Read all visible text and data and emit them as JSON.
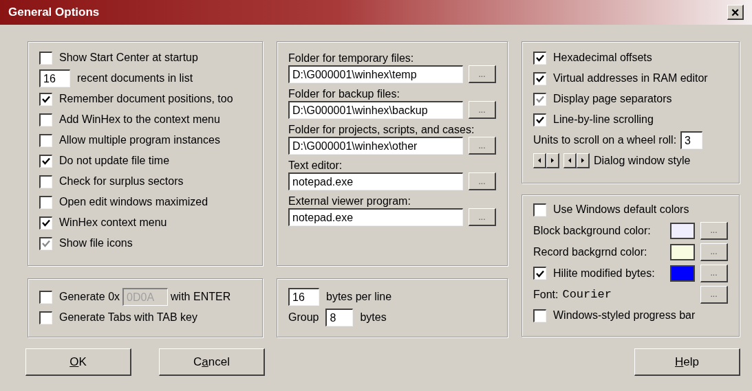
{
  "window": {
    "title": "General Options",
    "close": "×"
  },
  "general": [
    {
      "kind": "checkbox",
      "label": "Show Start Center at startup",
      "checked": false
    },
    {
      "kind": "number",
      "value": "16",
      "label": "recent documents in list"
    },
    {
      "kind": "checkbox",
      "label": "Remember document positions, too",
      "checked": true
    },
    {
      "kind": "checkbox",
      "label": "Add WinHex to the context menu",
      "checked": false
    },
    {
      "kind": "checkbox",
      "label": "Allow multiple program instances",
      "checked": false
    },
    {
      "kind": "checkbox",
      "label": "Do not update file time",
      "checked": true
    },
    {
      "kind": "checkbox",
      "label": "Check for surplus sectors",
      "checked": false
    },
    {
      "kind": "checkbox",
      "label": "Open edit windows maximized",
      "checked": false
    },
    {
      "kind": "checkbox",
      "label": "WinHex context menu",
      "checked": true
    },
    {
      "kind": "checkbox",
      "label": "Show file icons",
      "checked": true,
      "grayed": true
    }
  ],
  "folders": [
    {
      "label": "Folder for temporary files:",
      "value": "D:\\G000001\\winhex\\temp",
      "browse": "..."
    },
    {
      "label": "Folder for backup files:",
      "value": "D:\\G000001\\winhex\\backup",
      "browse": "..."
    },
    {
      "label": "Folder for projects, scripts, and cases:",
      "value": "D:\\G000001\\winhex\\other",
      "browse": "..."
    },
    {
      "label": "Text editor:",
      "value": "notepad.exe",
      "browse": "..."
    },
    {
      "label": "External viewer program:",
      "value": "notepad.exe",
      "browse": "..."
    }
  ],
  "display": [
    {
      "kind": "checkbox",
      "label": "Hexadecimal offsets",
      "checked": true
    },
    {
      "kind": "checkbox",
      "label": "Virtual addresses in RAM editor",
      "checked": true
    },
    {
      "kind": "checkbox",
      "label": "Display page separators",
      "checked": true,
      "grayed": true
    },
    {
      "kind": "checkbox",
      "label": "Line-by-line scrolling",
      "checked": true
    },
    {
      "kind": "number-after",
      "label": "Units to scroll on a wheel roll:",
      "value": "3"
    },
    {
      "kind": "style",
      "label": "Dialog window style"
    }
  ],
  "keyboard": [
    {
      "kind": "checkbox-field",
      "label": "Generate 0x",
      "value": "0D0A",
      "disabled": true,
      "suffix": "with ENTER",
      "checked": false
    },
    {
      "kind": "checkbox",
      "label": "Generate Tabs with TAB key",
      "checked": false
    }
  ],
  "layout": [
    {
      "kind": "number",
      "value": "16",
      "label": "bytes per line"
    },
    {
      "kind": "group",
      "label": "Group",
      "value": "8",
      "suffix": "bytes"
    }
  ],
  "colors": [
    {
      "kind": "checkbox",
      "label": "Use Windows default colors",
      "checked": false
    },
    {
      "kind": "color",
      "label": "Block background color:",
      "color": "#eeeefc",
      "browse": "..."
    },
    {
      "kind": "color",
      "label": "Record backgrnd color:",
      "color": "#f8fce0",
      "browse": "..."
    },
    {
      "kind": "checkbox-color",
      "label": "Hilite modified bytes:",
      "checked": true,
      "color": "#0000ff",
      "browse": "..."
    },
    {
      "kind": "font",
      "label": "Font:",
      "font": "Courier",
      "browse": "..."
    },
    {
      "kind": "checkbox",
      "label": "Windows-styled progress bar",
      "checked": false
    }
  ],
  "buttons": [
    {
      "key": "O",
      "after": "K"
    },
    {
      "before": "C",
      "key": "a",
      "after": "ncel"
    },
    {
      "key": "H",
      "after": "elp"
    }
  ]
}
